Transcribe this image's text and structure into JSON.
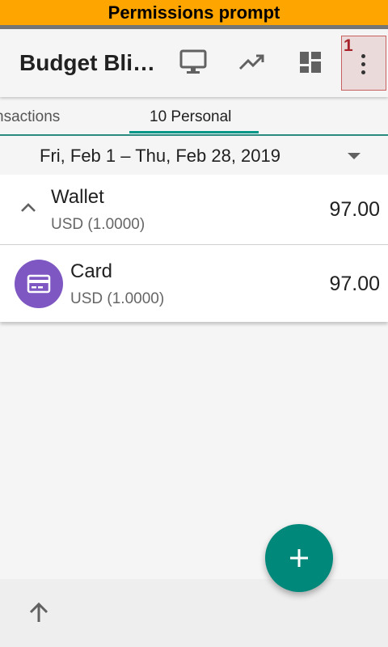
{
  "banner": {
    "text": "Permissions prompt"
  },
  "toolbar": {
    "title": "Budget Bli…",
    "icons": [
      "monitor-icon",
      "trending-up-icon",
      "dashboard-icon",
      "more-vertical-icon"
    ],
    "overflow_marker": "1"
  },
  "tabs": [
    {
      "label": "nsactions",
      "active": false
    },
    {
      "label": "10 Personal",
      "active": true
    }
  ],
  "date_range": {
    "text": "Fri, Feb 1 – Thu, Feb 28, 2019"
  },
  "accounts": [
    {
      "name": "Wallet",
      "currency": "USD (1.0000)",
      "amount": "97.00",
      "icon": "chevron-up-icon"
    },
    {
      "name": "Card",
      "currency": "USD (1.0000)",
      "amount": "97.00",
      "icon": "credit-card-icon"
    }
  ],
  "fab": {
    "icon": "plus-icon"
  },
  "bottom_bar": {
    "icon": "arrow-up-icon"
  },
  "colors": {
    "banner": "#ffa500",
    "accent": "#009688",
    "fab": "#00897b",
    "avatar": "#7e57c2"
  }
}
